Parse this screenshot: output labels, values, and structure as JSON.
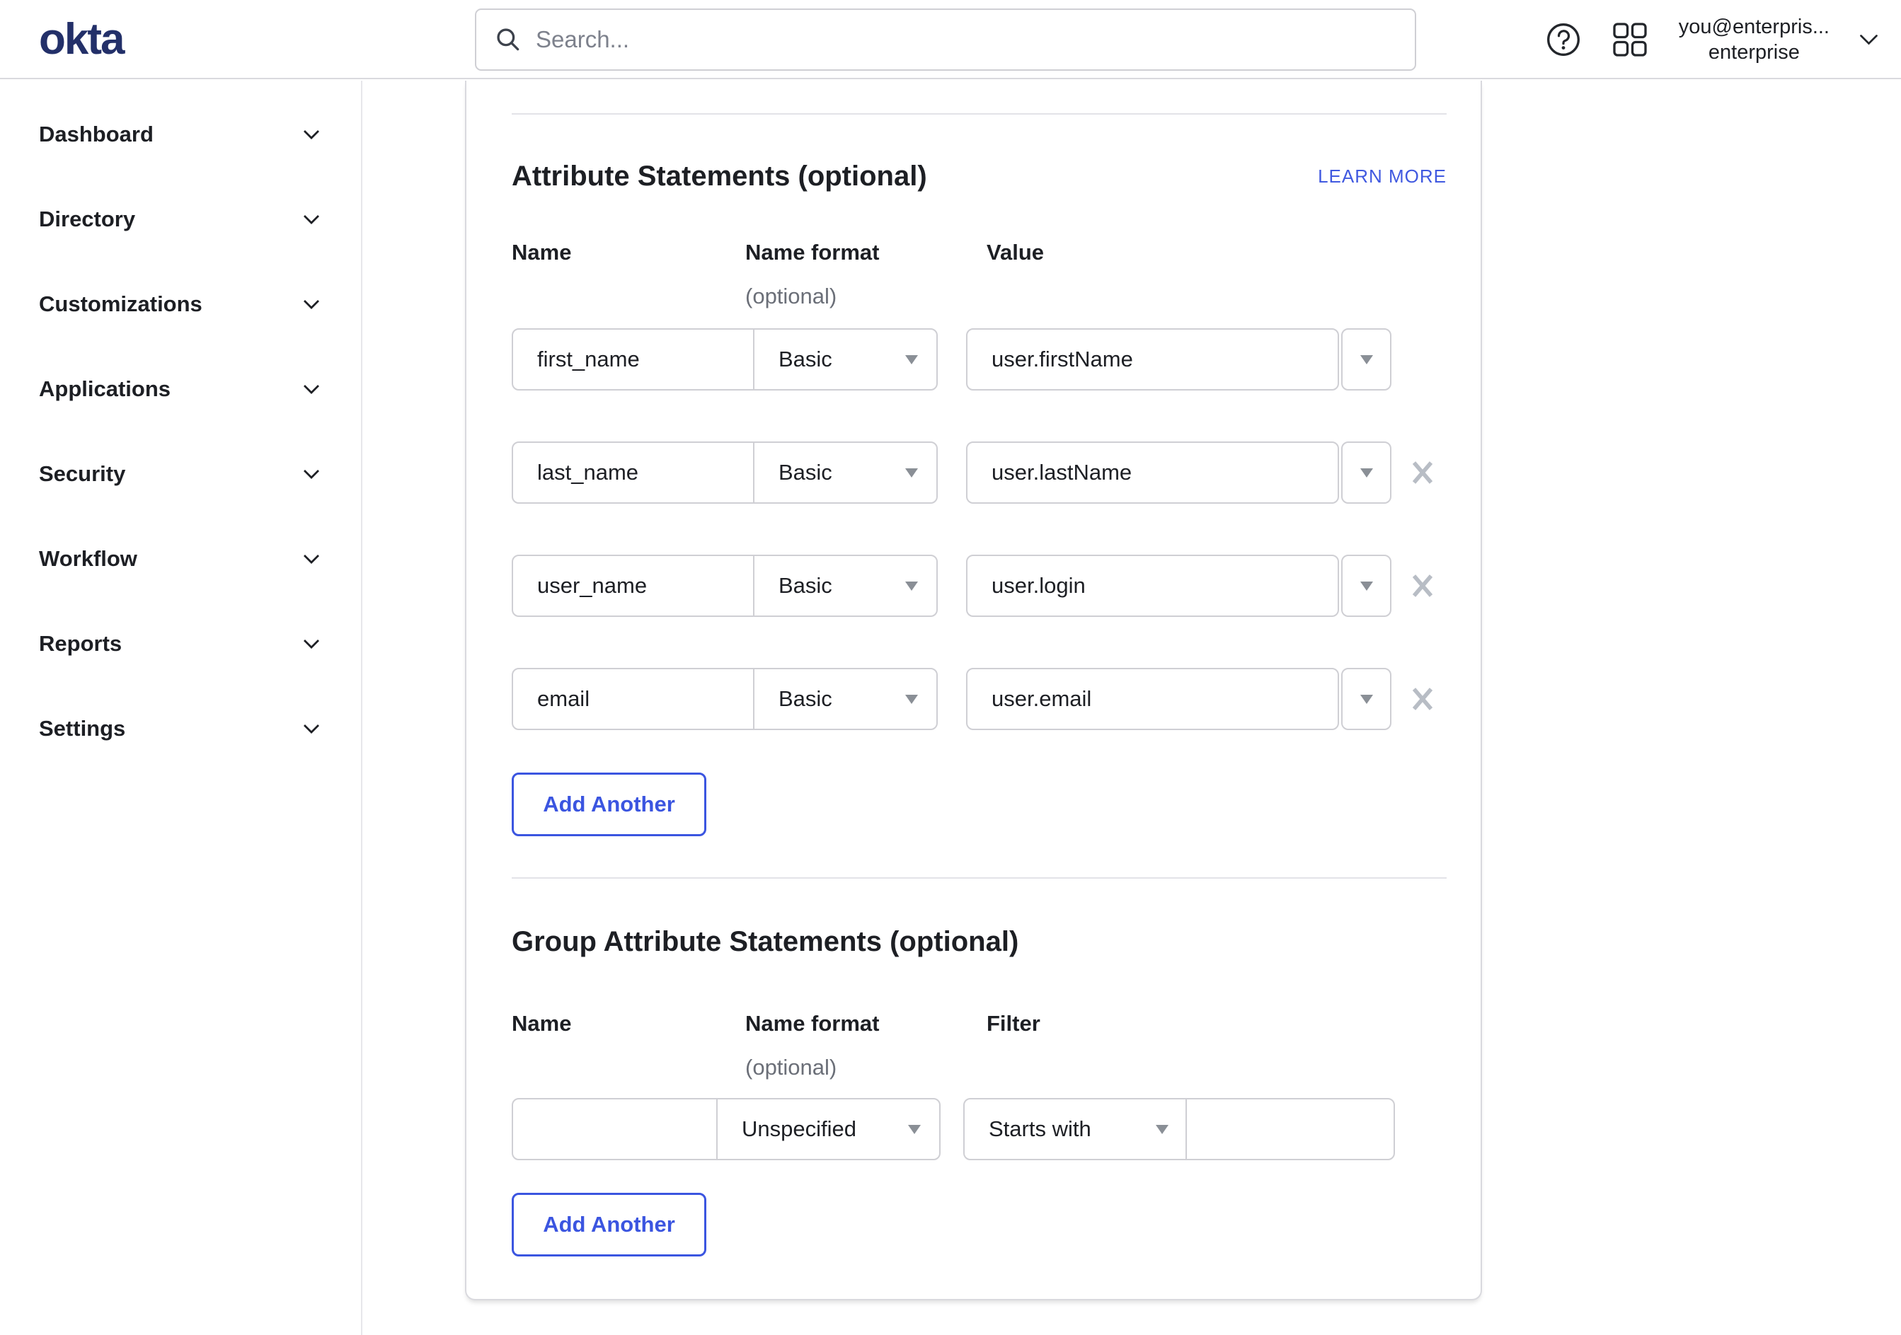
{
  "brand": {
    "logo_text": "okta",
    "logo_color": "#233069",
    "accent_blue": "#3b55e0"
  },
  "header": {
    "search": {
      "placeholder": "Search..."
    },
    "icons": {
      "search": "magnifier",
      "help": "question-mark-circle",
      "apps": "grid-2x2",
      "user_menu": "chevron-down"
    },
    "user": {
      "email": "you@enterpris...",
      "org": "enterprise"
    }
  },
  "sidebar": {
    "items": [
      "Dashboard",
      "Directory",
      "Customizations",
      "Applications",
      "Security",
      "Workflow",
      "Reports",
      "Settings"
    ]
  },
  "main": {
    "attribute_section": {
      "title": "Attribute Statements (optional)",
      "learn_more_label": "LEARN MORE",
      "columns": {
        "name": "Name",
        "name_format": "Name format",
        "name_format_note": "(optional)",
        "value": "Value"
      },
      "rows": [
        {
          "name": "first_name",
          "name_format": "Basic",
          "value": "user.firstName"
        },
        {
          "name": "last_name",
          "name_format": "Basic",
          "value": "user.lastName"
        },
        {
          "name": "user_name",
          "name_format": "Basic",
          "value": "user.login"
        },
        {
          "name": "email",
          "name_format": "Basic",
          "value": "user.email"
        }
      ],
      "add_button_label": "Add Another"
    },
    "group_section": {
      "title": "Group Attribute Statements (optional)",
      "columns": {
        "name": "Name",
        "name_format": "Name format",
        "name_format_note": "(optional)",
        "filter": "Filter"
      },
      "rows": [
        {
          "name": "",
          "name_format": "Unspecified",
          "filter_type": "Starts with",
          "filter_value": ""
        }
      ],
      "add_button_label": "Add Another"
    }
  }
}
